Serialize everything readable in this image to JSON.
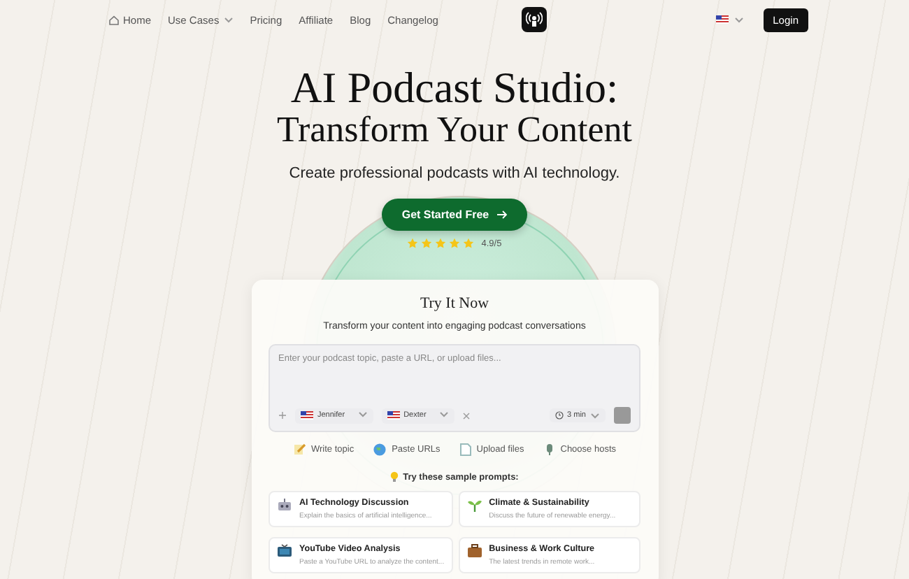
{
  "nav": {
    "links": [
      {
        "label": "Home",
        "kind": "home"
      },
      {
        "label": "Use Cases",
        "kind": "dropdown"
      },
      {
        "label": "Pricing",
        "kind": "plain"
      },
      {
        "label": "Affiliate",
        "kind": "plain"
      },
      {
        "label": "Blog",
        "kind": "plain"
      },
      {
        "label": "Changelog",
        "kind": "plain"
      }
    ],
    "login": "Login"
  },
  "hero": {
    "title_line_1": "AI Podcast Studio:",
    "title_line_2": "Transform Your Content",
    "subtitle": "Create professional podcasts with AI technology.",
    "cta": "Get Started Free",
    "stars": 5,
    "rating": "4.9/5"
  },
  "try_card": {
    "title": "Try It Now",
    "subtitle": "Transform your content into engaging podcast conversations",
    "input": {
      "placeholder": "Enter your podcast topic, paste a URL, or upload files..."
    },
    "hosts": [
      {
        "name": "Jennifer"
      },
      {
        "name": "Dexter"
      }
    ],
    "duration": "3 min",
    "actions": [
      {
        "label": "Write topic",
        "kind": "pencil"
      },
      {
        "label": "Paste URLs",
        "kind": "globe"
      },
      {
        "label": "Upload files",
        "kind": "file"
      },
      {
        "label": "Choose hosts",
        "kind": "mic"
      }
    ],
    "prompts_label": "Try these sample prompts:",
    "prompts": [
      {
        "title": "AI Technology Discussion",
        "description": "Explain the basics of artificial intelligence...",
        "kind": "robot"
      },
      {
        "title": "Climate & Sustainability",
        "description": "Discuss the future of renewable energy...",
        "kind": "plant"
      },
      {
        "title": "YouTube Video Analysis",
        "description": "Paste a YouTube URL to analyze the content...",
        "kind": "tv"
      },
      {
        "title": "Business & Work Culture",
        "description": "The latest trends in remote work...",
        "kind": "briefcase"
      }
    ]
  }
}
